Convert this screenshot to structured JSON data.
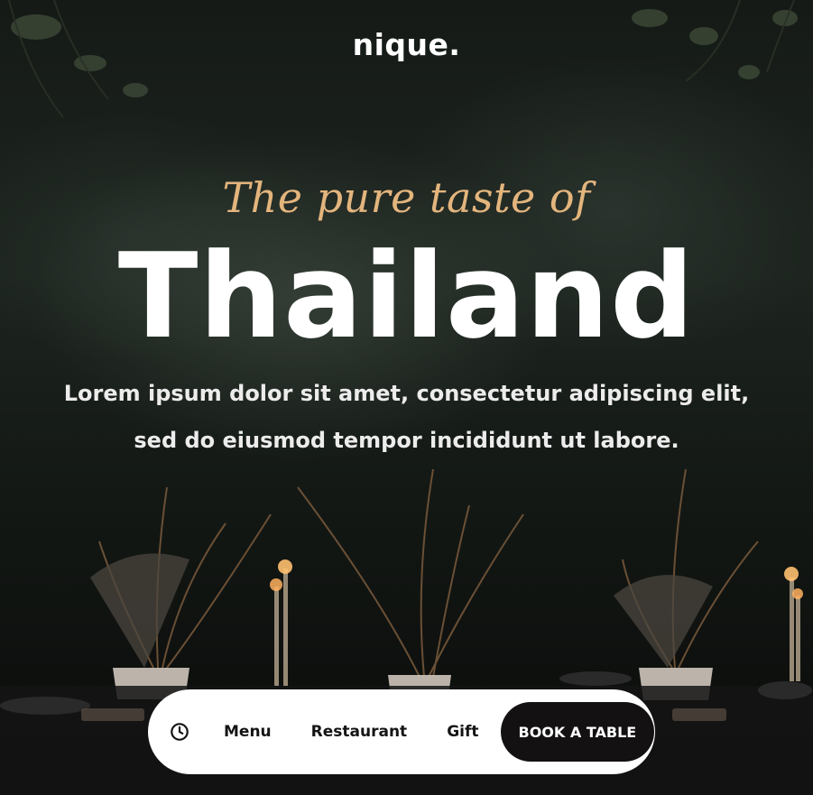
{
  "brand": {
    "name": "nique."
  },
  "hero": {
    "tagline": "The pure taste of",
    "headline": "Thailand",
    "description": "Lorem ipsum dolor sit amet, consectetur adipiscing elit, sed do eiusmod tempor incididunt ut labore."
  },
  "nav": {
    "clock_icon": "clock-icon",
    "items": [
      {
        "label": "Menu"
      },
      {
        "label": "Restaurant"
      },
      {
        "label": "Gift"
      }
    ],
    "cta_label": "BOOK A TABLE"
  },
  "colors": {
    "accent": "#e3b57d",
    "nav_background": "#ffffff",
    "cta_background": "#141112"
  }
}
